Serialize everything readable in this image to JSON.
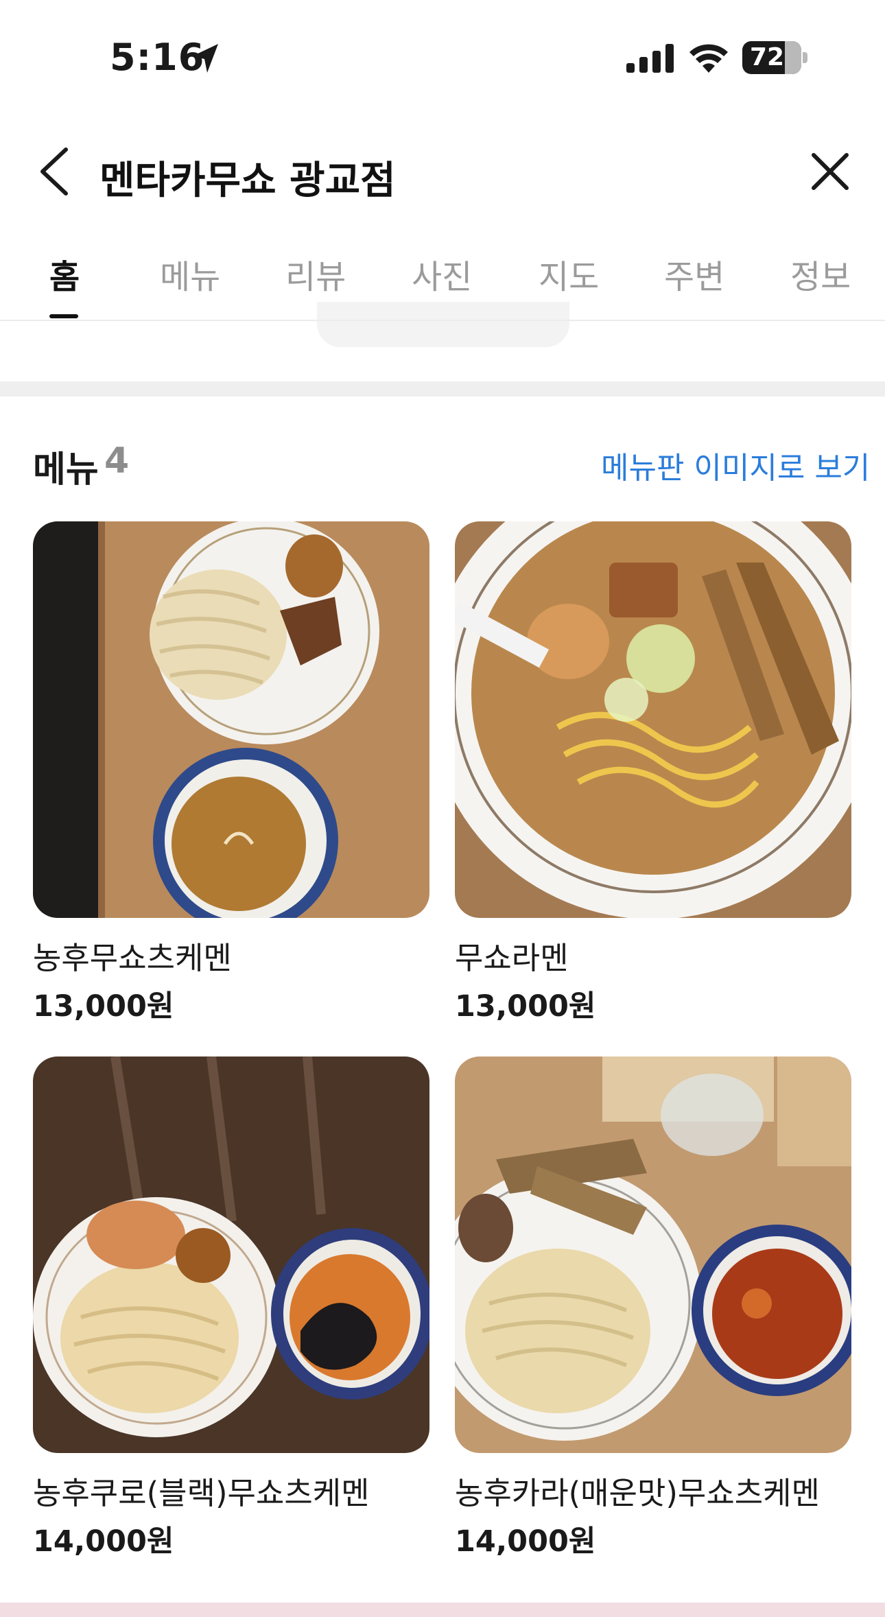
{
  "status_bar": {
    "time": "5:16",
    "battery": "72",
    "icons": [
      "location-arrow-icon",
      "cellular-signal-icon",
      "wifi-icon",
      "battery-icon"
    ]
  },
  "header": {
    "title": "멘타카무쇼 광교점",
    "back_icon": "chevron-left-icon",
    "close_icon": "close-icon"
  },
  "tabs": [
    {
      "label": "홈",
      "active": true
    },
    {
      "label": "메뉴",
      "active": false
    },
    {
      "label": "리뷰",
      "active": false
    },
    {
      "label": "사진",
      "active": false
    },
    {
      "label": "지도",
      "active": false
    },
    {
      "label": "주변",
      "active": false
    },
    {
      "label": "정보",
      "active": false
    }
  ],
  "menu_section": {
    "heading": "메뉴",
    "count": "4",
    "board_link": "메뉴판 이미지로 보기",
    "items": [
      {
        "name": "농후무쇼츠케멘",
        "price": "13,000원"
      },
      {
        "name": "무쇼라멘",
        "price": "13,000원"
      },
      {
        "name": "농후쿠로(블랙)무쇼츠케멘",
        "price": "14,000원"
      },
      {
        "name": "농후카라(매운맛)무쇼츠케멘",
        "price": "14,000원"
      }
    ]
  },
  "colors": {
    "accent_link": "#2b7ddb",
    "active_tab": "#111111",
    "inactive_tab": "#9b9b9b",
    "divider": "#efefef"
  }
}
